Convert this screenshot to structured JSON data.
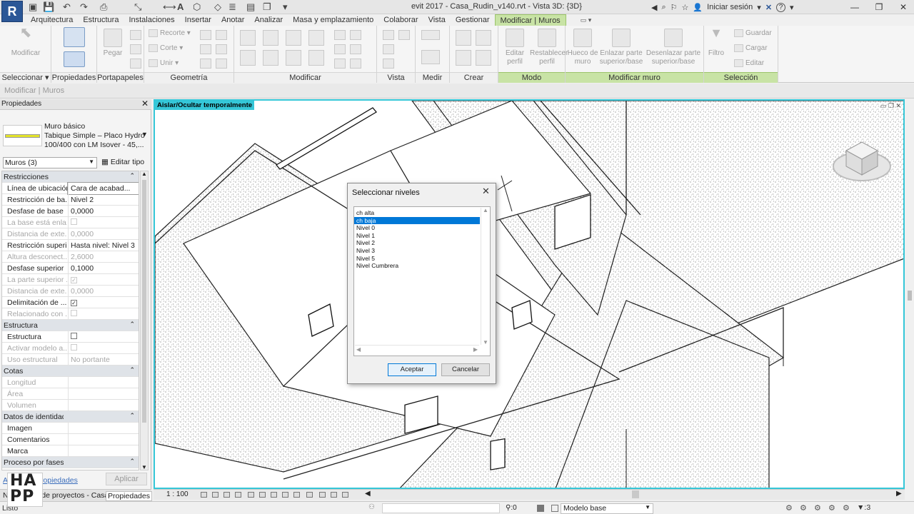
{
  "app": {
    "logo_letter": "R"
  },
  "window": {
    "title": "evit 2017 -    Casa_Rudin_v140.rvt - Vista 3D: {3D}"
  },
  "topbar": {
    "sign_in": "Iniciar sesión",
    "help": "?"
  },
  "tabs": [
    "Arquitectura",
    "Estructura",
    "Instalaciones",
    "Insertar",
    "Anotar",
    "Analizar",
    "Masa y emplazamiento",
    "Colaborar",
    "Vista",
    "Gestionar",
    "Modificar | Muros"
  ],
  "active_tab_index": 10,
  "ribbon": {
    "select": {
      "button": "Modificar",
      "label": "Seleccionar ▾"
    },
    "properties": {
      "label": "Propiedades"
    },
    "clipboard": {
      "button": "Pegar",
      "label": "Portapapeles"
    },
    "geometry": {
      "items": [
        "Recorte",
        "Corte",
        "Unir"
      ],
      "label": "Geometría"
    },
    "modify": {
      "label": "Modificar"
    },
    "view": {
      "label": "Vista"
    },
    "measure": {
      "label": "Medir"
    },
    "create": {
      "label": "Crear"
    },
    "mode": {
      "buttons": [
        "Editar perfil",
        "Restablecer perfil"
      ],
      "label": "Modo"
    },
    "modify_wall": {
      "buttons": [
        "Hueco de muro",
        "Enlazar parte superior/base",
        "Desenlazar parte superior/base"
      ],
      "label": "Modificar muro"
    },
    "selection": {
      "filter": "Filtro",
      "items": [
        "Guardar",
        "Cargar",
        "Editar"
      ],
      "label": "Selección"
    }
  },
  "options_bar": {
    "text": "Modificar | Muros"
  },
  "properties": {
    "header": "Propiedades",
    "type_family": "Muro básico",
    "type_name_1": "Tabique Simple – Placo Hydro",
    "type_name_2": "100/400 con LM Isover - 45,...",
    "filter": "Muros (3)",
    "edit_type": "Editar tipo",
    "rows": [
      {
        "k": "Restricciones",
        "group": true
      },
      {
        "k": "Línea de ubicación",
        "v": "Cara de acabad...",
        "sel": true
      },
      {
        "k": "Restricción de ba...",
        "v": "Nivel 2"
      },
      {
        "k": "Desfase de base",
        "v": "0,0000"
      },
      {
        "k": "La base está enla...",
        "v": "",
        "chk": "",
        "dis": true
      },
      {
        "k": "Distancia de exte...",
        "v": "0,0000",
        "dis": true
      },
      {
        "k": "Restricción superi...",
        "v": "Hasta nivel: Nivel 3"
      },
      {
        "k": "Altura desconect...",
        "v": "2,6000",
        "dis": true
      },
      {
        "k": "Desfase superior",
        "v": "0,1000"
      },
      {
        "k": "La parte superior ...",
        "v": "",
        "chk": "✓",
        "dis": true
      },
      {
        "k": "Distancia de exte...",
        "v": "0,0000",
        "dis": true
      },
      {
        "k": "Delimitación de ...",
        "v": "",
        "chk": "✓"
      },
      {
        "k": "Relacionado con ...",
        "v": "",
        "chk": "",
        "dis": true
      },
      {
        "k": "Estructura",
        "group": true
      },
      {
        "k": "Estructura",
        "v": "",
        "chk": ""
      },
      {
        "k": "Activar modelo a...",
        "v": "",
        "chk": "",
        "dis": true
      },
      {
        "k": "Uso estructural",
        "v": "No portante",
        "dis": true
      },
      {
        "k": "Cotas",
        "group": true
      },
      {
        "k": "Longitud",
        "v": "",
        "dis": true
      },
      {
        "k": "Área",
        "v": "",
        "dis": true
      },
      {
        "k": "Volumen",
        "v": "",
        "dis": true
      },
      {
        "k": "Datos de identidad",
        "group": true
      },
      {
        "k": "Imagen",
        "v": ""
      },
      {
        "k": "Comentarios",
        "v": ""
      },
      {
        "k": "Marca",
        "v": ""
      },
      {
        "k": "Proceso por fases",
        "group": true
      }
    ],
    "help_link": "Ayuda de propiedades",
    "apply": "Aplicar",
    "bottom_tab_1": "Navegador de proyectos - Casa_...",
    "bottom_tab_2": "Propiedades"
  },
  "canvas": {
    "mode_label": "Aislar/Ocultar temporalmente"
  },
  "view_control": {
    "scale": "1 : 100"
  },
  "status": {
    "left": "Listo",
    "model": "Modelo base",
    "count": ":0",
    "filter_count": ":3"
  },
  "dialog": {
    "title": "Seleccionar niveles",
    "levels": [
      "ch alta",
      "ch baja",
      "Nivel 0",
      "Nivel 1",
      "Nivel 2",
      "Nivel 3",
      "Nivel 5",
      "Nivel Cumbrera"
    ],
    "selected_index": 1,
    "ok": "Aceptar",
    "cancel": "Cancelar"
  },
  "watermark": {
    "text": "HAPP"
  },
  "colors": {
    "accent_cyan": "#35c7d8",
    "context_green": "#c8e3a5",
    "selection_blue": "#0078d7"
  }
}
